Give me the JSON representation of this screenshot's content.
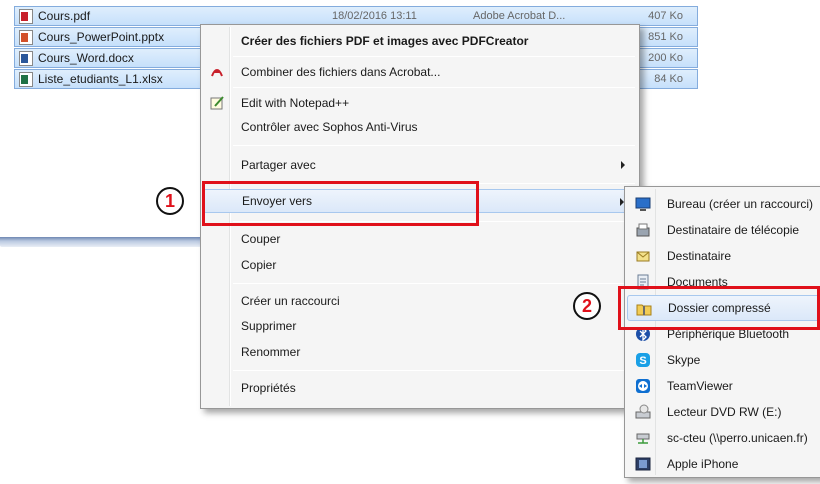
{
  "files": [
    {
      "name": "Cours.pdf",
      "date": "18/02/2016 13:11",
      "type": "Adobe Acrobat D...",
      "size": "407 Ko",
      "icon": "pdf-file-icon"
    },
    {
      "name": "Cours_PowerPoint.pptx",
      "date": "",
      "type": "",
      "size": "851 Ko",
      "icon": "pptx-file-icon"
    },
    {
      "name": "Cours_Word.docx",
      "date": "",
      "type": "",
      "size": "200 Ko",
      "icon": "docx-file-icon"
    },
    {
      "name": "Liste_etudiants_L1.xlsx",
      "date": "",
      "type": "",
      "size": "84 Ko",
      "icon": "xlsx-file-icon"
    }
  ],
  "context_menu": {
    "create_pdf": "Créer des fichiers PDF et images avec PDFCreator",
    "combine_acrobat": "Combiner des fichiers dans Acrobat...",
    "edit_notepad": "Edit with Notepad++",
    "sophos": "Contrôler avec Sophos Anti-Virus",
    "share_with": "Partager avec",
    "send_to": "Envoyer vers",
    "cut": "Couper",
    "copy": "Copier",
    "create_shortcut": "Créer un raccourci",
    "delete": "Supprimer",
    "rename": "Renommer",
    "properties": "Propriétés"
  },
  "send_to_menu": [
    {
      "label": "Bureau (créer un raccourci)",
      "icon": "desktop-icon"
    },
    {
      "label": "Destinataire de télécopie",
      "icon": "fax-icon"
    },
    {
      "label": "Destinataire",
      "icon": "mail-recipient-icon"
    },
    {
      "label": "Documents",
      "icon": "documents-icon"
    },
    {
      "label": "Dossier compressé",
      "icon": "zip-folder-icon"
    },
    {
      "label": "Périphérique Bluetooth",
      "icon": "bluetooth-icon"
    },
    {
      "label": "Skype",
      "icon": "skype-icon"
    },
    {
      "label": "TeamViewer",
      "icon": "teamviewer-icon"
    },
    {
      "label": "Lecteur DVD RW (E:)",
      "icon": "dvd-drive-icon"
    },
    {
      "label": "sc-cteu (\\\\perro.unicaen.fr)",
      "icon": "network-drive-icon"
    },
    {
      "label": "Apple iPhone",
      "icon": "iphone-icon"
    }
  ],
  "annotations": {
    "step1": "1",
    "step2": "2"
  },
  "colors": {
    "highlight_red": "#e0101a",
    "selection_blue": "#c6e0fb"
  }
}
